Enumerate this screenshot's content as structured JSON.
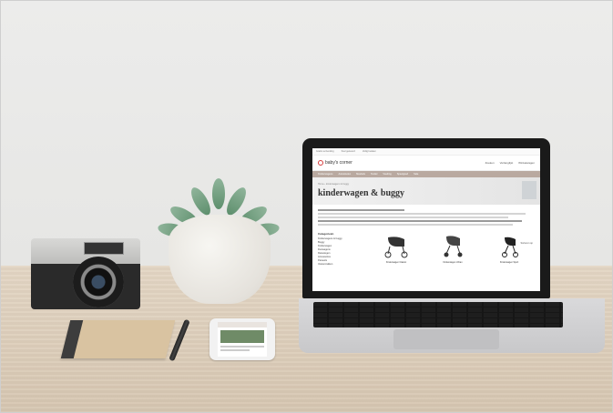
{
  "scene": {
    "description_free": true
  },
  "laptop_screen": {
    "util_links": [
      "Gratis verzending",
      "Snel geleverd",
      "Veilig betalen"
    ],
    "logo_text": "baby's corner",
    "header_actions": [
      "Zoeken",
      "Verlanglijst",
      "Winkelwagen"
    ],
    "nav_items": [
      "Kinderwagens",
      "Autostoelen",
      "Meubels",
      "Textiel",
      "Voeding",
      "Speelgoed",
      "Sale"
    ],
    "breadcrumb": "Home › kinderwagens & buggy",
    "page_title": "kinderwagen & buggy",
    "filter_heading": "Categorieën",
    "filter_items": [
      "Kinderwagens & buggy",
      "Buggy",
      "Kinderwagen",
      "Duowagens",
      "Reiswiegen",
      "Accessoires",
      "Parasols",
      "Voetenzakken"
    ],
    "sort_label": "Sorteren op",
    "products": [
      {
        "name": "Kinderwagen Classic"
      },
      {
        "name": "Kinderwagen Urban"
      },
      {
        "name": "Kinderwagen Sport"
      }
    ]
  },
  "colors": {
    "brand_red": "#d63b3b",
    "nav_bg": "#b9a9a0"
  }
}
